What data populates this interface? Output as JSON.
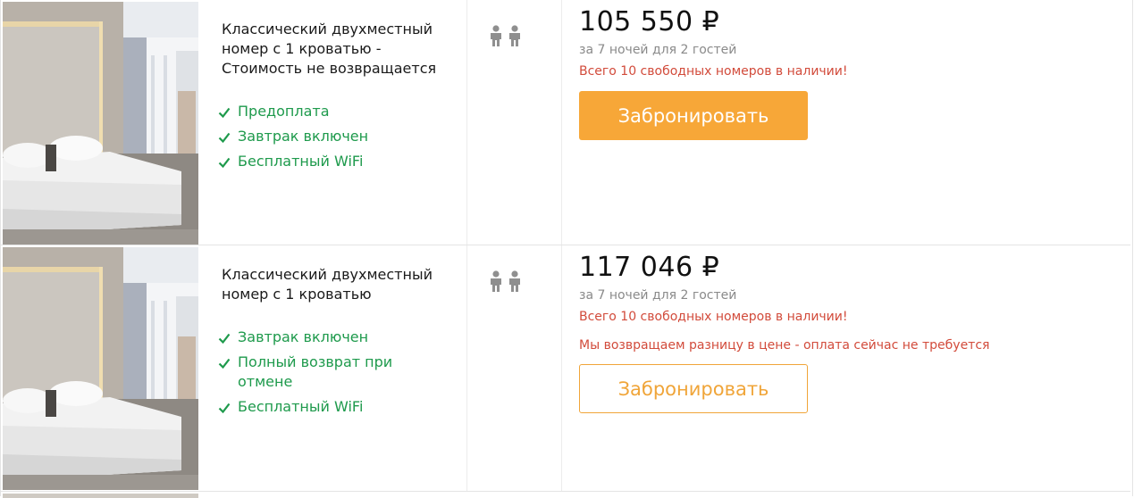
{
  "rooms": [
    {
      "title": "Классический двухместный номер с 1 кроватью - Стоимость не возвращается",
      "features": [
        "Предоплата",
        "Завтрак включен",
        "Бесплатный WiFi"
      ],
      "guests_icon": "two-persons-icon",
      "price": "105 550 ₽",
      "nights_text": "за 7 ночей для 2 гостей",
      "availability": "Всего 10 свободных номеров в наличии!",
      "refund_note": "",
      "book_label": "Забронировать"
    },
    {
      "title": "Классический двухместный номер с 1 кроватью",
      "features": [
        "Завтрак включен",
        "Полный возврат при отмене",
        "Бесплатный WiFi"
      ],
      "guests_icon": "two-persons-icon",
      "price": "117 046 ₽",
      "nights_text": "за 7 ночей для 2 гостей",
      "availability": "Всего 10 свободных номеров в наличии!",
      "refund_note": "Мы возвращаем разницу в цене - оплата сейчас не требуется",
      "book_label": "Забронировать"
    }
  ],
  "colors": {
    "feature_green": "#1e9a4c",
    "alert_red": "#d24b3b",
    "book_orange": "#f7a738",
    "muted_gray": "#8a8a8a"
  }
}
